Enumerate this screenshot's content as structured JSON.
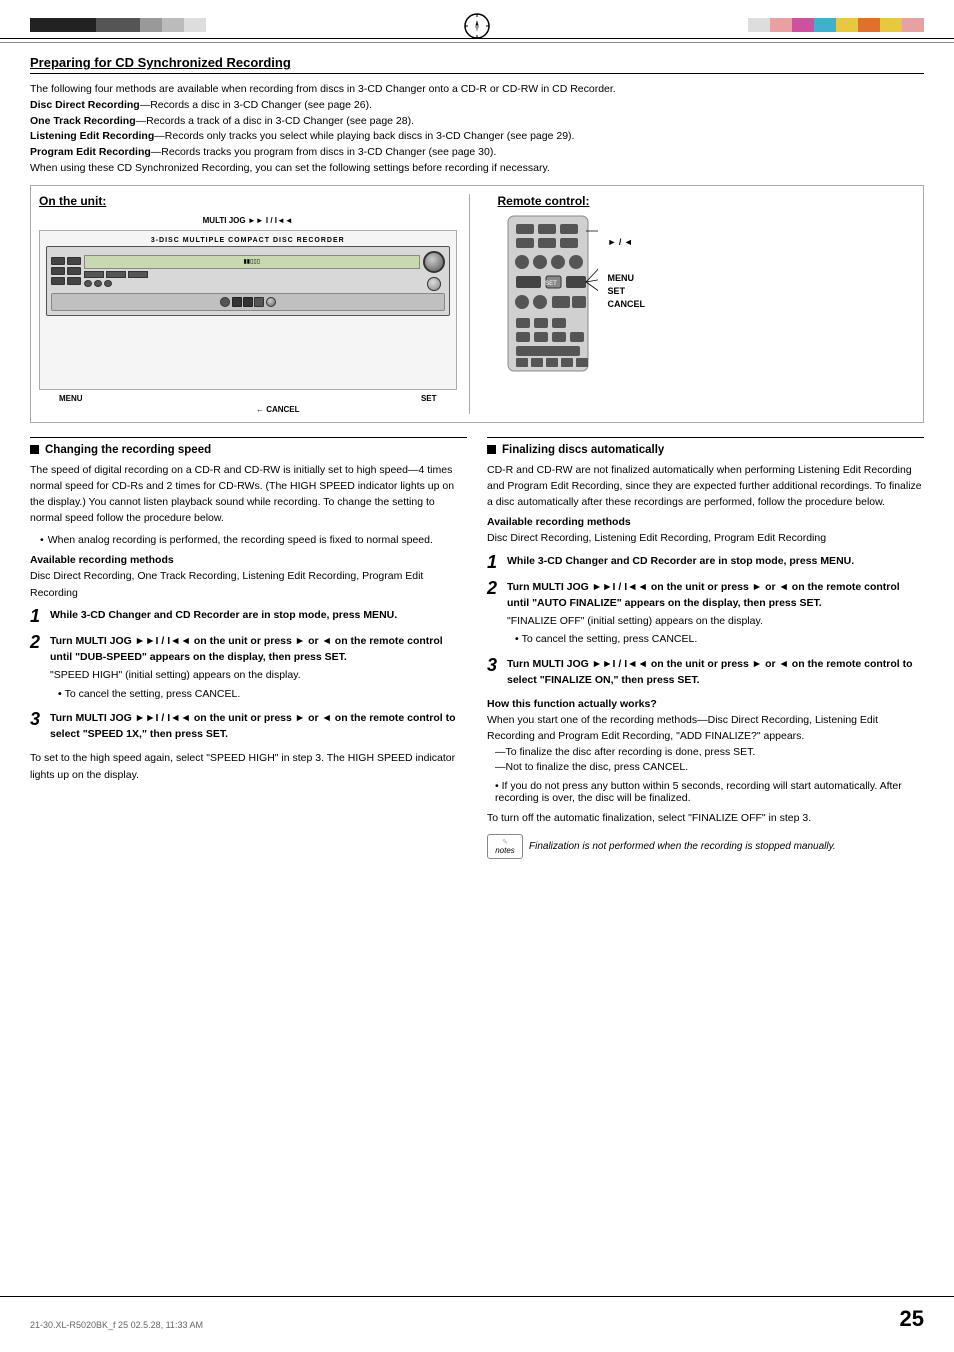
{
  "page": {
    "number": "25",
    "footer_text": "21-30.XL-R5020BK_f          25          02.5.28, 11:33 AM"
  },
  "top_bars_left": [
    "dark",
    "dark",
    "dark",
    "med",
    "med",
    "light",
    "lighter",
    "lightest"
  ],
  "top_bars_right": [
    "pink",
    "magenta",
    "cyan",
    "yellow",
    "orange",
    "yellow",
    "pink",
    "magenta"
  ],
  "section_title": "Preparing for CD Synchronized Recording",
  "intro": {
    "line1": "The following four methods are available when recording from discs in 3-CD Changer onto a CD-R or CD-RW in CD Recorder.",
    "disc_direct": "Disc Direct Recording",
    "disc_direct_desc": "—Records a disc in 3-CD Changer (see page 26).",
    "one_track": "One Track Recording",
    "one_track_desc": "—Records a track of a disc in 3-CD Changer (see page 28).",
    "listening": "Listening Edit Recording",
    "listening_desc": "—Records only tracks you select while playing back discs in 3-CD Changer (see page 29).",
    "program": "Program Edit Recording",
    "program_desc": "—Records tracks you program from discs in 3-CD Changer (see page 30).",
    "line_last": "When using these CD Synchronized Recording, you can set the following settings before recording if necessary."
  },
  "diagram": {
    "left_title": "On the unit:",
    "right_title": "Remote control:",
    "multijog_label": "MULTI JOG ►► I / I◄◄",
    "cancel_label": "CANCEL",
    "menu_label": "MENU",
    "set_label": "SET",
    "remote_menu": "MENU",
    "remote_set": "SET",
    "remote_cancel": "CANCEL",
    "play_label": "► / ◄"
  },
  "left_col": {
    "header": "Changing the recording speed",
    "para1": "The speed of digital recording on a  CD-R and CD-RW is initially set to high speed—4 times normal speed for CD-Rs and 2 times for CD-RWs. (The HIGH SPEED indicator lights up on the display.) You cannot listen playback sound while recording. To change the setting to normal speed follow the procedure below.",
    "bullet1": "When analog recording is performed, the recording speed is fixed to normal speed.",
    "sub_header1": "Available recording methods",
    "methods1": "Disc Direct Recording, One Track Recording, Listening Edit Recording, Program Edit Recording",
    "step1_num": "1",
    "step1_text": "While 3-CD Changer and CD Recorder are in stop mode, press MENU.",
    "step2_num": "2",
    "step2_text": "Turn MULTI JOG ►►I / I◄◄ on the unit or press ► or ◄ on the remote control until \"DUB-SPEED\" appears on the display, then press SET.",
    "step2_sub": "\"SPEED HIGH\" (initial setting) appears on the display.",
    "step2_bullet": "To cancel the setting, press CANCEL.",
    "step3_num": "3",
    "step3_text": "Turn MULTI JOG ►►I / I◄◄ on the unit or press ► or ◄ on the remote control to select \"SPEED 1X,\" then press SET.",
    "to_set_text": "To set to the high speed again,",
    "to_set_desc": " select \"SPEED HIGH\" in step 3. The HIGH SPEED indicator lights up on the display."
  },
  "right_col": {
    "header": "Finalizing discs automatically",
    "para1": "CD-R and CD-RW are not finalized automatically when performing Listening Edit Recording and Program Edit Recording, since they are expected further additional recordings. To finalize a disc automatically after these recordings are performed, follow the procedure below.",
    "sub_header1": "Available recording methods",
    "methods1": "Disc Direct Recording, Listening Edit Recording, Program Edit Recording",
    "step1_num": "1",
    "step1_text": "While 3-CD Changer and CD Recorder are in stop mode, press MENU.",
    "step2_num": "2",
    "step2_text": "Turn MULTI JOG ►►I / I◄◄ on the unit or press ► or ◄ on the remote control until \"AUTO FINALIZE\" appears on the display, then press SET.",
    "step2_sub": "\"FINALIZE OFF\" (initial setting) appears on the display.",
    "step2_bullet": "To cancel the setting, press CANCEL.",
    "step3_num": "3",
    "step3_text": "Turn MULTI JOG ►►I / I◄◄ on the unit or press ► or ◄ on the remote control to select \"FINALIZE ON,\" then press SET.",
    "how_works_header": "How this function actually works?",
    "how_works_text": "When you start one of the recording methods—Disc Direct Recording, Listening Edit Recording and Program Edit Recording, \"ADD FINALIZE?\" appears.",
    "dash1": "—To finalize the disc after recording is done, press SET.",
    "dash2": "—Not to finalize the disc, press CANCEL.",
    "bullet2": "If you do not press any button within 5 seconds, recording will start automatically. After recording is over, the disc will be finalized.",
    "to_turn_text": "To turn off the automatic finalization,",
    "to_turn_desc": " select \"FINALIZE OFF\" in step 3.",
    "notes_label": "notes",
    "notes_text": "Finalization is not performed when the recording is stopped manually."
  }
}
